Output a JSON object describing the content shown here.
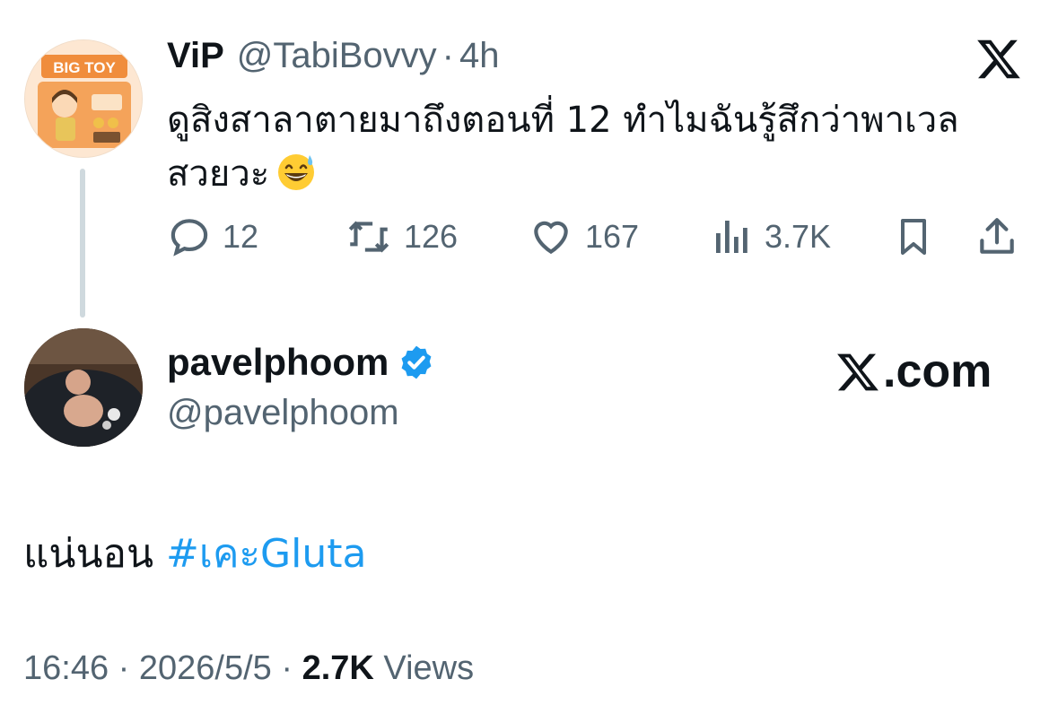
{
  "parent_tweet": {
    "avatar_text": "BIG TOY",
    "display_name": "ViP",
    "handle": "@TabiBovvy",
    "separator": "·",
    "time": "4h",
    "text": "ดูสิงสาลาตายมาถึงตอนที่ 12 ทำไมฉันรู้สึกว่าพาเวลสวยวะ",
    "emoji": "grinning-face-with-sweat",
    "actions": {
      "replies": "12",
      "reposts": "126",
      "likes": "167",
      "views": "3.7K"
    }
  },
  "reply_tweet": {
    "display_name": "pavelphoom",
    "handle": "@pavelphoom",
    "verified": true,
    "site": ".com",
    "text": "แน่นอน",
    "hashtag": "#เคะGluta",
    "time": "16:46",
    "separator": "·",
    "date": "2026/5/5",
    "views_count": "2.7K",
    "views_label": "Views"
  },
  "colors": {
    "text": "#0f1419",
    "secondary": "#536471",
    "accent": "#1d9bf0",
    "thread_line": "#cfd9de"
  }
}
